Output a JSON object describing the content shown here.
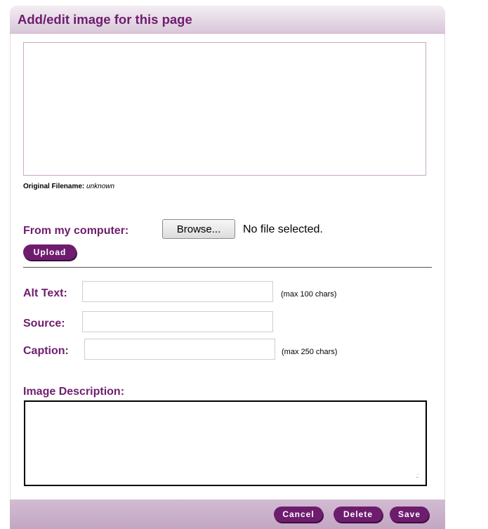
{
  "dialog": {
    "title": "Add/edit image for this page"
  },
  "file_info": {
    "label": "Original Filename:",
    "value": "unknown"
  },
  "upload": {
    "from_label": "From my computer:",
    "browse_label": "Browse...",
    "status": "No file selected.",
    "upload_label": "Upload"
  },
  "fields": {
    "alt_text": {
      "label": "Alt Text:",
      "value": "",
      "hint": "(max 100 chars)"
    },
    "source": {
      "label": "Source:",
      "value": ""
    },
    "caption": {
      "label": "Caption:",
      "value": "",
      "hint": "(max 250 chars)"
    },
    "description": {
      "label": "Image Description:",
      "value": ""
    }
  },
  "footer": {
    "cancel_label": "Cancel",
    "delete_label": "Delete",
    "save_label": "Save"
  },
  "colors": {
    "accent": "#6e1c6e",
    "title_text": "#6f1d6f",
    "footer_bg": "#c9aec9"
  }
}
